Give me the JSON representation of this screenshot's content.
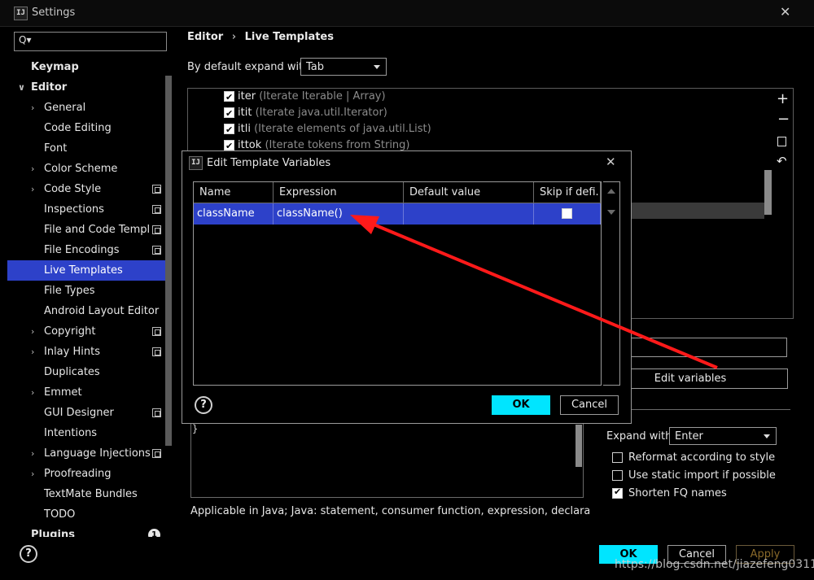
{
  "window": {
    "title": "Settings"
  },
  "search": {
    "placeholder": "Q▾"
  },
  "sidebar": {
    "items": [
      {
        "label": "Keymap"
      },
      {
        "label": "Editor"
      },
      {
        "label": "General"
      },
      {
        "label": "Code Editing"
      },
      {
        "label": "Font"
      },
      {
        "label": "Color Scheme"
      },
      {
        "label": "Code Style"
      },
      {
        "label": "Inspections"
      },
      {
        "label": "File and Code Templates"
      },
      {
        "label": "File Encodings"
      },
      {
        "label": "Live Templates"
      },
      {
        "label": "File Types"
      },
      {
        "label": "Android Layout Editor"
      },
      {
        "label": "Copyright"
      },
      {
        "label": "Inlay Hints"
      },
      {
        "label": "Duplicates"
      },
      {
        "label": "Emmet"
      },
      {
        "label": "GUI Designer"
      },
      {
        "label": "Intentions"
      },
      {
        "label": "Language Injections"
      },
      {
        "label": "Proofreading"
      },
      {
        "label": "TextMate Bundles"
      },
      {
        "label": "TODO"
      },
      {
        "label": "Plugins"
      }
    ],
    "plugins_badge": "1"
  },
  "breadcrumb": {
    "parent": "Editor",
    "sep": "›",
    "current": "Live Templates"
  },
  "expand_default": {
    "label": "By default expand with",
    "value": "Tab"
  },
  "templates": [
    {
      "abbr": "iter",
      "desc": "(Iterate Iterable | Array)"
    },
    {
      "abbr": "itit",
      "desc": "(Iterate java.util.Iterator)"
    },
    {
      "abbr": "itli",
      "desc": "(Iterate elements of java.util.List)"
    },
    {
      "abbr": "ittok",
      "desc": "(Iterate tokens from String)"
    }
  ],
  "toolbar_icons": [
    "plus-icon",
    "minus-icon",
    "copy-icon",
    "undo-icon"
  ],
  "edit_variables": {
    "label": "Edit variables"
  },
  "options": {
    "expand_with_label": "Expand with",
    "expand_with_value": "Enter",
    "reformat": "Reformat according to style",
    "static_import": "Use static import if possible",
    "shorten_fq": "Shorten FQ names"
  },
  "editor_text": "}",
  "applicable": "Applicable in Java; Java: statement, consumer function, expression, declaration, con",
  "footer": {
    "ok": "OK",
    "cancel": "Cancel",
    "apply": "Apply",
    "help": "?"
  },
  "watermark": "https://blog.csdn.net/jiazefeng0311",
  "dialog": {
    "title": "Edit Template Variables",
    "columns": [
      "Name",
      "Expression",
      "Default value",
      "Skip if defi..."
    ],
    "row": {
      "name": "className",
      "expression": "className()",
      "default": ""
    },
    "ok": "OK",
    "cancel": "Cancel",
    "help": "?"
  },
  "colors": {
    "selection": "#2d41c9",
    "primary_button": "#00e5ff",
    "annotation_arrow": "#ff1a1a"
  }
}
